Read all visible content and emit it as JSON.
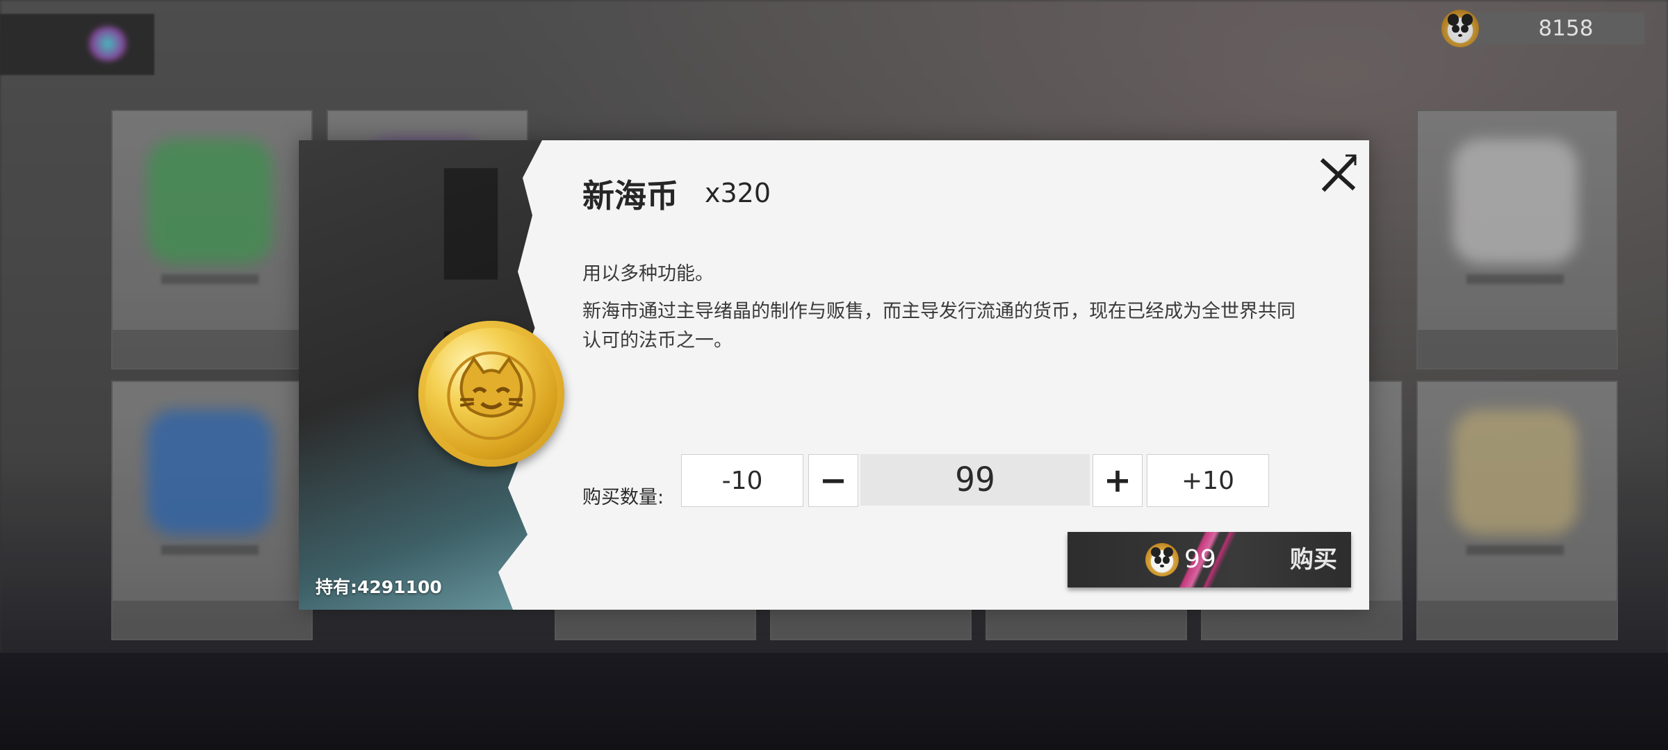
{
  "currency": {
    "icon": "panda-coin-icon",
    "amount": "8158"
  },
  "item": {
    "name": "新海币",
    "count": "x320",
    "description_short": "用以多种功能。",
    "description_long": "新海市通过主导绪晶的制作与贩售，而主导发行流通的货币，现在已经成为全世界共同认可的法币之一。",
    "holding": "持有:4291100",
    "icon": "new-sea-coin-icon"
  },
  "purchase": {
    "quantity_label": "购买数量:",
    "minus10_label": "-10",
    "quantity_value": "99",
    "plus10_label": "+10",
    "price": "99",
    "buy_label": "购买"
  }
}
